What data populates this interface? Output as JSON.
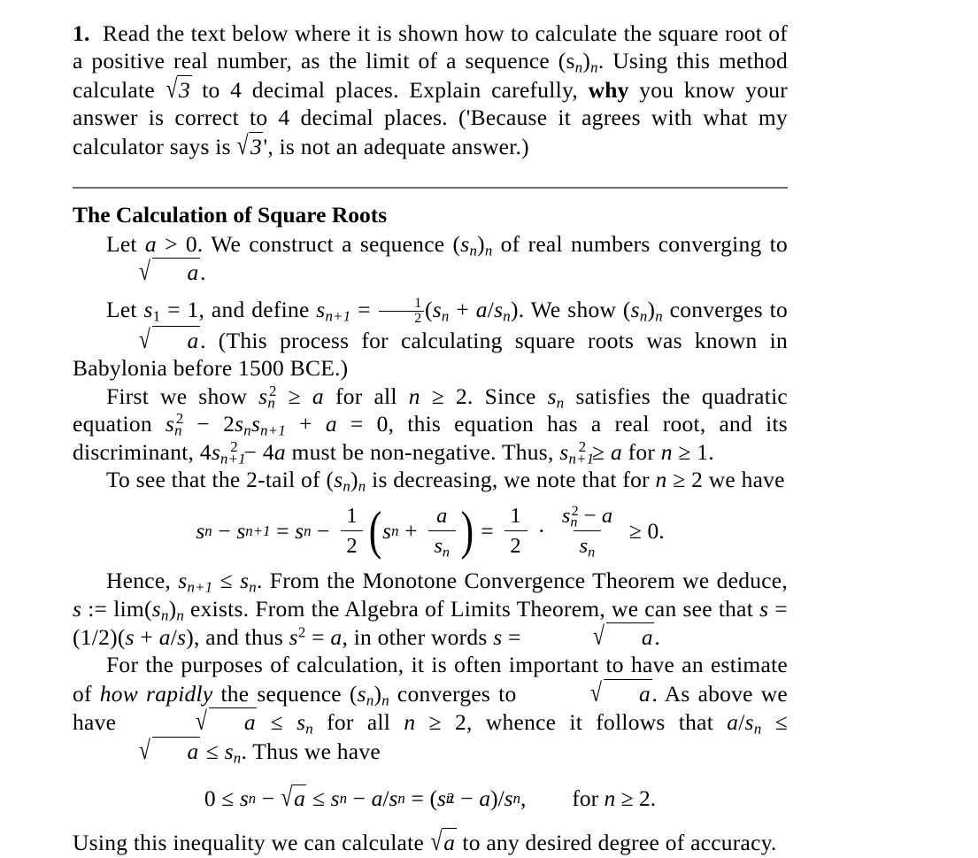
{
  "document": {
    "question": {
      "number": "1.",
      "text_parts": [
        "Read the text below where it is shown how to calculate the square root of a positive real number, as the limit of a sequence (s",
        "n",
        ")",
        "n",
        ". Using this method calculate ",
        "3",
        " to 4 decimal places. Explain carefully, ",
        "why",
        " you know your answer is correct to 4 decimal places. ('Because it agrees with what my calculator says is ",
        "3",
        "', is not an adequate answer.)"
      ],
      "full_text": "1. Read the text below where it is shown how to calculate the square root of a positive real number, as the limit of a sequence (s_n)_n. Using this method calculate √3 to 4 decimal places. Explain carefully, why you know your answer is correct to 4 decimal places. ('Because it agrees with what my calculator says is √3', is not an adequate answer.)",
      "emphasis_word": "why",
      "decimal_places": "4",
      "radicand": "3"
    },
    "section": {
      "heading": "The Calculation of Square Roots",
      "paragraphs": [
        {
          "id": "p-let-a",
          "full_text": "Let a > 0. We construct a sequence (s_n)_n of real numbers converging to √a."
        },
        {
          "id": "p-define",
          "full_text": "Let s_1 = 1, and define s_{n+1} = ½(s_n + a/s_n). We show (s_n)_n converges to √a. (This process for calculating square roots was known in Babylonia before 1500 BCE.)",
          "era": "1500 BCE"
        },
        {
          "id": "p-first-show",
          "full_text": "First we show s_n^2 ≥ a for all n ≥ 2. Since s_n satisfies the quadratic equation s_n^2 − 2 s_n s_{n+1} + a = 0, this equation has a real root, and its discriminant, 4 s_{n+1}^2 − 4a must be non-negative. Thus, s_{n+1}^2 ≥ a for n ≥ 1."
        },
        {
          "id": "p-two-tail",
          "full_text": "To see that the 2-tail of (s_n)_n is decreasing, we note that for n ≥ 2 we have"
        },
        {
          "id": "p-hence",
          "full_text": "Hence, s_{n+1} ≤ s_n. From the Monotone Convergence Theorem we deduce, s := lim(s_n)_n exists. From the Algebra of Limits Theorem, we can see that s = (1/2)(s + a/s), and thus s^2 = a, in other words s = √a.",
          "theorem_1": "Monotone Convergence Theorem",
          "theorem_2": "Algebra of Limits Theorem"
        },
        {
          "id": "p-estimate",
          "full_text": "For the purposes of calculation, it is often important to have an estimate of how rapidly the sequence (s_n)_n converges to √a. As above we have √a ≤ s_n for all n ≥ 2, whence it follows that a/s_n ≤ √a ≤ s_n. Thus we have",
          "italic_phrase": "how rapidly"
        },
        {
          "id": "p-closing",
          "full_text": "Using this inequality we can calculate √a to any desired degree of accuracy."
        }
      ],
      "equations": [
        {
          "id": "eq-decreasing",
          "latex": "s_n - s_{n+1} = s_n - \\frac{1}{2}\\left(s_n + \\frac{a}{s_n}\\right) = \\frac{1}{2}\\cdot\\frac{s_n^2-a}{s_n} \\ge 0.",
          "plain": "s_n − s_{n+1} = s_n − (1/2)(s_n + a/s_n) = (1/2)·(s_n^2 − a)/s_n ≥ 0."
        },
        {
          "id": "eq-error-bound",
          "latex": "0 \\le s_n - \\sqrt{a} \\le s_n - a/s_n = (s_n^2-a)/s_n, \\qquad \\text{for } n \\ge 2.",
          "plain": "0 ≤ s_n − √a ≤ s_n − a/s_n = (s_n^2 − a)/s_n,   for n ≥ 2.",
          "condition": "for n ≥ 2."
        }
      ]
    },
    "symbols": {
      "radical": "√",
      "ge": "≥",
      "le": "≤",
      "minus": "−",
      "plus": "+",
      "equals": "=",
      "cdot": "·",
      "define_equals": ":=",
      "period": ".",
      "comma": ",",
      "lparen": "(",
      "rparen": ")"
    },
    "style": {
      "page_background": "#ffffff",
      "text_color": "#000000",
      "rule_color": "#6f6f6f"
    }
  }
}
